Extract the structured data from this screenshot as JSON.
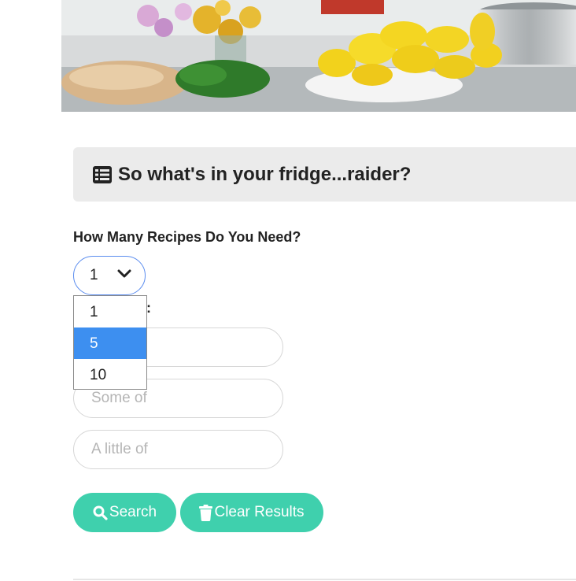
{
  "hero": {
    "image_name": "kitchen-counter-lemons-photo"
  },
  "panel": {
    "title": "So what's in your fridge...raider?",
    "icon": "list-icon"
  },
  "recipes": {
    "label": "How Many Recipes Do You Need?",
    "selected": "1",
    "options": [
      "1",
      "5",
      "10"
    ],
    "highlighted": "5"
  },
  "ingredients": {
    "label_visible": "ts:",
    "fields": [
      {
        "placeholder": "",
        "value": ""
      },
      {
        "placeholder": "Some of",
        "value": ""
      },
      {
        "placeholder": "A little of",
        "value": ""
      }
    ]
  },
  "buttons": {
    "search_label": "Search",
    "clear_label": "Clear Results"
  },
  "colors": {
    "accent": "#3fd0ad",
    "select_border": "#5b8def",
    "option_highlight": "#3d8ff0",
    "panel_bg": "#ebebeb"
  }
}
